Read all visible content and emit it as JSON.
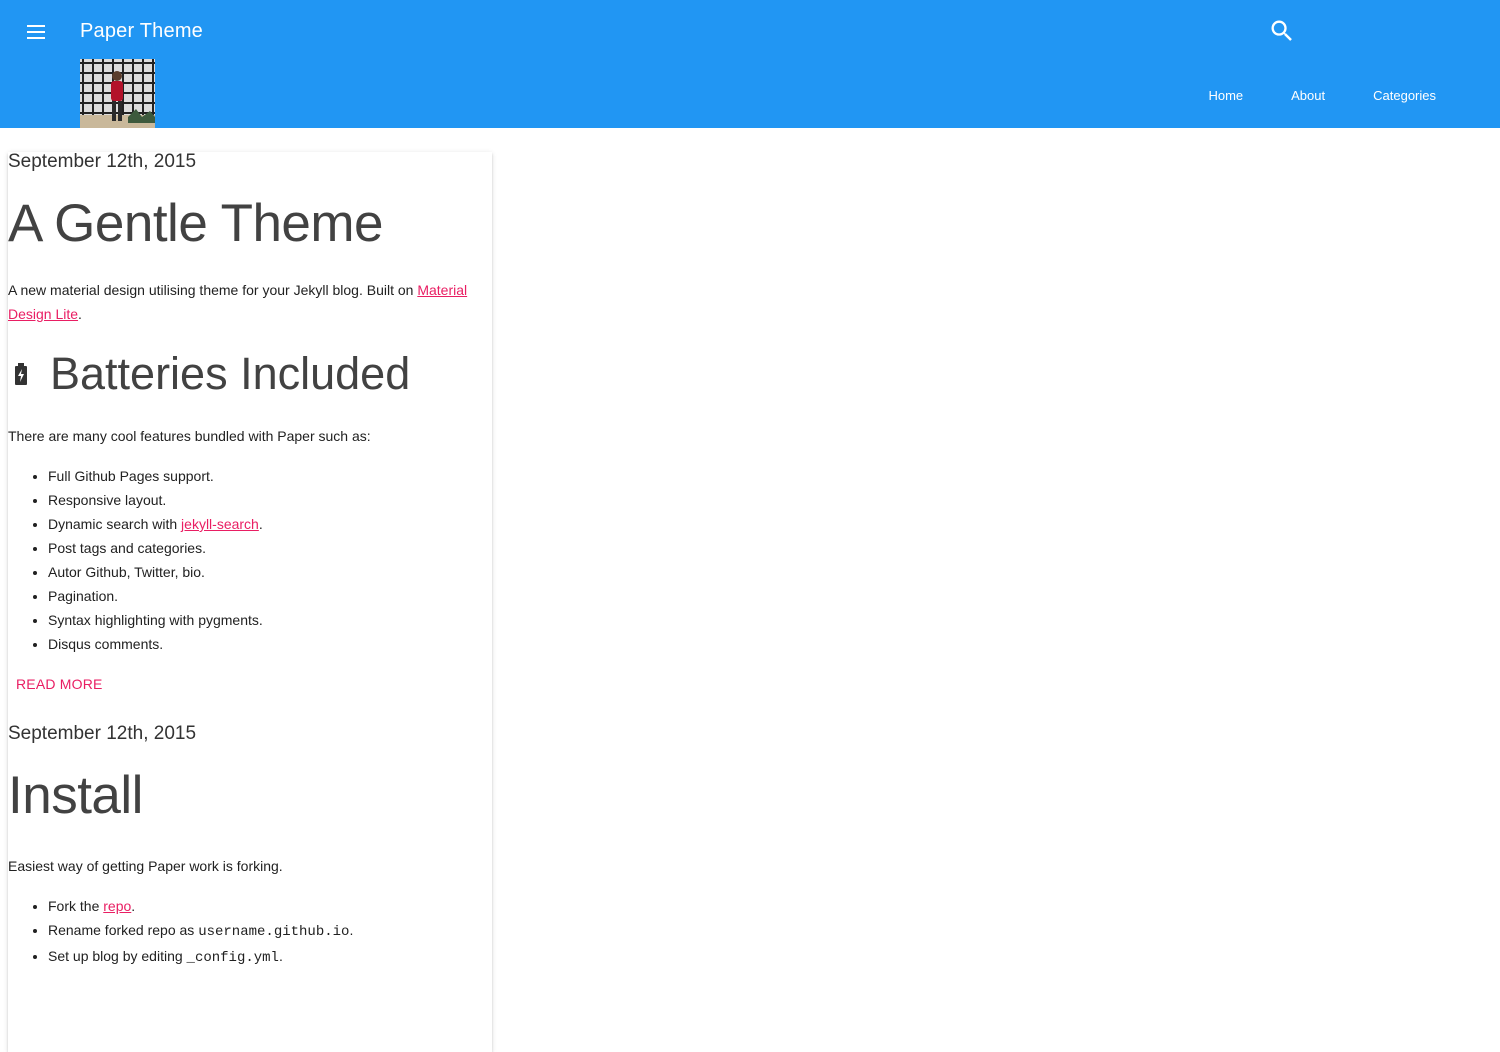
{
  "header": {
    "site_title": "Paper Theme",
    "nav": [
      {
        "label": "Home"
      },
      {
        "label": "About"
      },
      {
        "label": "Categories"
      }
    ]
  },
  "colors": {
    "header_bg": "#2196f3",
    "accent": "#e91e63",
    "heading": "#424242"
  },
  "icons": [
    "menu-icon",
    "search-icon",
    "battery-charging-icon"
  ],
  "posts": [
    {
      "date": "September 12th, 2015",
      "title": "A Gentle Theme",
      "intro_text": "A new material design utilising theme for your Jekyll blog. Built on ",
      "intro_link": "Material Design Lite",
      "intro_end": ".",
      "section_heading": "Batteries Included",
      "features_intro": "There are many cool features bundled with Paper such as:",
      "features": [
        {
          "text": "Full Github Pages support."
        },
        {
          "text": "Responsive layout."
        },
        {
          "text": "Dynamic search with ",
          "link": "jekyll-search",
          "after": "."
        },
        {
          "text": "Post tags and categories."
        },
        {
          "text": "Autor Github, Twitter, bio."
        },
        {
          "text": "Pagination."
        },
        {
          "text": "Syntax highlighting with pygments."
        },
        {
          "text": "Disqus comments."
        }
      ],
      "read_more": "READ MORE"
    },
    {
      "date": "September 12th, 2015",
      "title": "Install",
      "intro_text": "Easiest way of getting Paper work is forking.",
      "steps": [
        {
          "before": "Fork the ",
          "link": "repo",
          "after": "."
        },
        {
          "before": "Rename forked repo as ",
          "code": "username.github.io",
          "after": "."
        },
        {
          "before": "Set up blog by editing ",
          "code": "_config.yml",
          "after": "."
        }
      ]
    }
  ]
}
